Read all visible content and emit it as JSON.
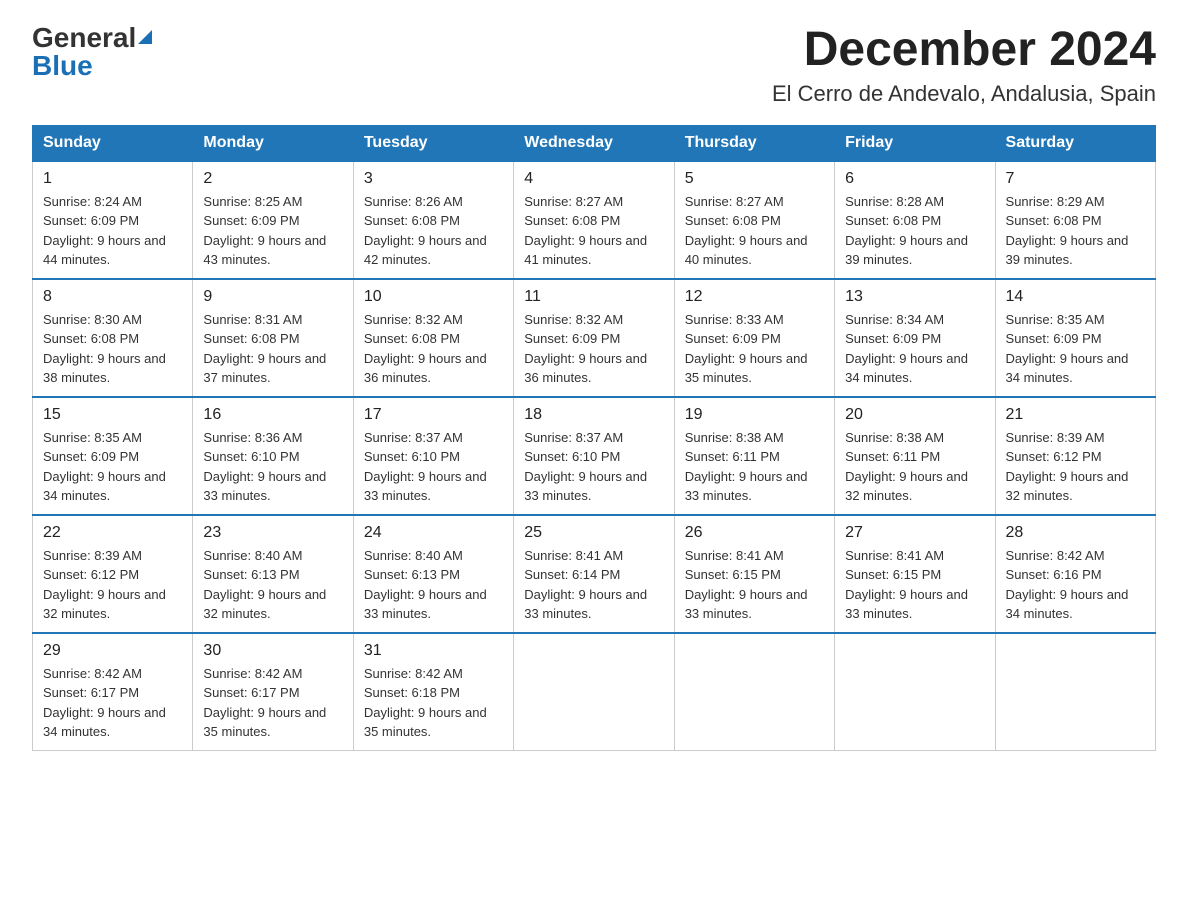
{
  "header": {
    "logo_general": "General",
    "logo_blue": "Blue",
    "title": "December 2024",
    "subtitle": "El Cerro de Andevalo, Andalusia, Spain"
  },
  "weekdays": [
    "Sunday",
    "Monday",
    "Tuesday",
    "Wednesday",
    "Thursday",
    "Friday",
    "Saturday"
  ],
  "weeks": [
    [
      {
        "day": "1",
        "sunrise": "8:24 AM",
        "sunset": "6:09 PM",
        "daylight": "9 hours and 44 minutes."
      },
      {
        "day": "2",
        "sunrise": "8:25 AM",
        "sunset": "6:09 PM",
        "daylight": "9 hours and 43 minutes."
      },
      {
        "day": "3",
        "sunrise": "8:26 AM",
        "sunset": "6:08 PM",
        "daylight": "9 hours and 42 minutes."
      },
      {
        "day": "4",
        "sunrise": "8:27 AM",
        "sunset": "6:08 PM",
        "daylight": "9 hours and 41 minutes."
      },
      {
        "day": "5",
        "sunrise": "8:27 AM",
        "sunset": "6:08 PM",
        "daylight": "9 hours and 40 minutes."
      },
      {
        "day": "6",
        "sunrise": "8:28 AM",
        "sunset": "6:08 PM",
        "daylight": "9 hours and 39 minutes."
      },
      {
        "day": "7",
        "sunrise": "8:29 AM",
        "sunset": "6:08 PM",
        "daylight": "9 hours and 39 minutes."
      }
    ],
    [
      {
        "day": "8",
        "sunrise": "8:30 AM",
        "sunset": "6:08 PM",
        "daylight": "9 hours and 38 minutes."
      },
      {
        "day": "9",
        "sunrise": "8:31 AM",
        "sunset": "6:08 PM",
        "daylight": "9 hours and 37 minutes."
      },
      {
        "day": "10",
        "sunrise": "8:32 AM",
        "sunset": "6:08 PM",
        "daylight": "9 hours and 36 minutes."
      },
      {
        "day": "11",
        "sunrise": "8:32 AM",
        "sunset": "6:09 PM",
        "daylight": "9 hours and 36 minutes."
      },
      {
        "day": "12",
        "sunrise": "8:33 AM",
        "sunset": "6:09 PM",
        "daylight": "9 hours and 35 minutes."
      },
      {
        "day": "13",
        "sunrise": "8:34 AM",
        "sunset": "6:09 PM",
        "daylight": "9 hours and 34 minutes."
      },
      {
        "day": "14",
        "sunrise": "8:35 AM",
        "sunset": "6:09 PM",
        "daylight": "9 hours and 34 minutes."
      }
    ],
    [
      {
        "day": "15",
        "sunrise": "8:35 AM",
        "sunset": "6:09 PM",
        "daylight": "9 hours and 34 minutes."
      },
      {
        "day": "16",
        "sunrise": "8:36 AM",
        "sunset": "6:10 PM",
        "daylight": "9 hours and 33 minutes."
      },
      {
        "day": "17",
        "sunrise": "8:37 AM",
        "sunset": "6:10 PM",
        "daylight": "9 hours and 33 minutes."
      },
      {
        "day": "18",
        "sunrise": "8:37 AM",
        "sunset": "6:10 PM",
        "daylight": "9 hours and 33 minutes."
      },
      {
        "day": "19",
        "sunrise": "8:38 AM",
        "sunset": "6:11 PM",
        "daylight": "9 hours and 33 minutes."
      },
      {
        "day": "20",
        "sunrise": "8:38 AM",
        "sunset": "6:11 PM",
        "daylight": "9 hours and 32 minutes."
      },
      {
        "day": "21",
        "sunrise": "8:39 AM",
        "sunset": "6:12 PM",
        "daylight": "9 hours and 32 minutes."
      }
    ],
    [
      {
        "day": "22",
        "sunrise": "8:39 AM",
        "sunset": "6:12 PM",
        "daylight": "9 hours and 32 minutes."
      },
      {
        "day": "23",
        "sunrise": "8:40 AM",
        "sunset": "6:13 PM",
        "daylight": "9 hours and 32 minutes."
      },
      {
        "day": "24",
        "sunrise": "8:40 AM",
        "sunset": "6:13 PM",
        "daylight": "9 hours and 33 minutes."
      },
      {
        "day": "25",
        "sunrise": "8:41 AM",
        "sunset": "6:14 PM",
        "daylight": "9 hours and 33 minutes."
      },
      {
        "day": "26",
        "sunrise": "8:41 AM",
        "sunset": "6:15 PM",
        "daylight": "9 hours and 33 minutes."
      },
      {
        "day": "27",
        "sunrise": "8:41 AM",
        "sunset": "6:15 PM",
        "daylight": "9 hours and 33 minutes."
      },
      {
        "day": "28",
        "sunrise": "8:42 AM",
        "sunset": "6:16 PM",
        "daylight": "9 hours and 34 minutes."
      }
    ],
    [
      {
        "day": "29",
        "sunrise": "8:42 AM",
        "sunset": "6:17 PM",
        "daylight": "9 hours and 34 minutes."
      },
      {
        "day": "30",
        "sunrise": "8:42 AM",
        "sunset": "6:17 PM",
        "daylight": "9 hours and 35 minutes."
      },
      {
        "day": "31",
        "sunrise": "8:42 AM",
        "sunset": "6:18 PM",
        "daylight": "9 hours and 35 minutes."
      },
      null,
      null,
      null,
      null
    ]
  ]
}
